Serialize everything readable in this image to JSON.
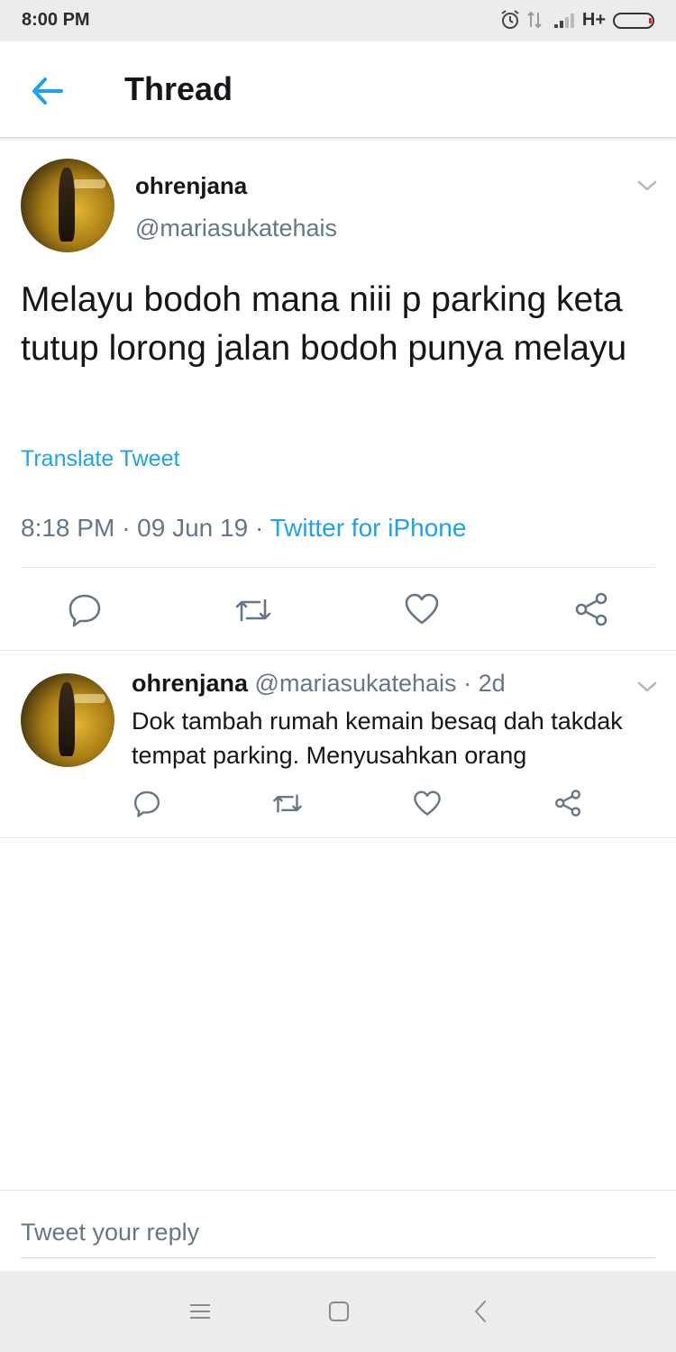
{
  "status_bar": {
    "time": "8:00 PM",
    "network": "H+",
    "icons": [
      "alarm-icon",
      "data-arrows-icon",
      "signal-icon",
      "battery-icon"
    ]
  },
  "header": {
    "title": "Thread"
  },
  "main_tweet": {
    "name": "ohrenjana",
    "handle": "@mariasukatehais",
    "text": "Melayu bodoh mana niii p parking keta tutup lorong jalan bodoh punya melayu",
    "translate_label": "Translate Tweet",
    "time": "8:18 PM",
    "date": "09 Jun 19",
    "source": "Twitter for iPhone"
  },
  "reply_tweet": {
    "name": "ohrenjana",
    "handle": "@mariasukatehais",
    "age": "2d",
    "text": "Dok tambah rumah kemain besaq dah takdak tempat parking. Menyusahkan orang"
  },
  "reply_box": {
    "placeholder": "Tweet your reply"
  },
  "colors": {
    "accent": "#1da1f2",
    "secondary_text": "#657786",
    "icon": "#657786"
  }
}
